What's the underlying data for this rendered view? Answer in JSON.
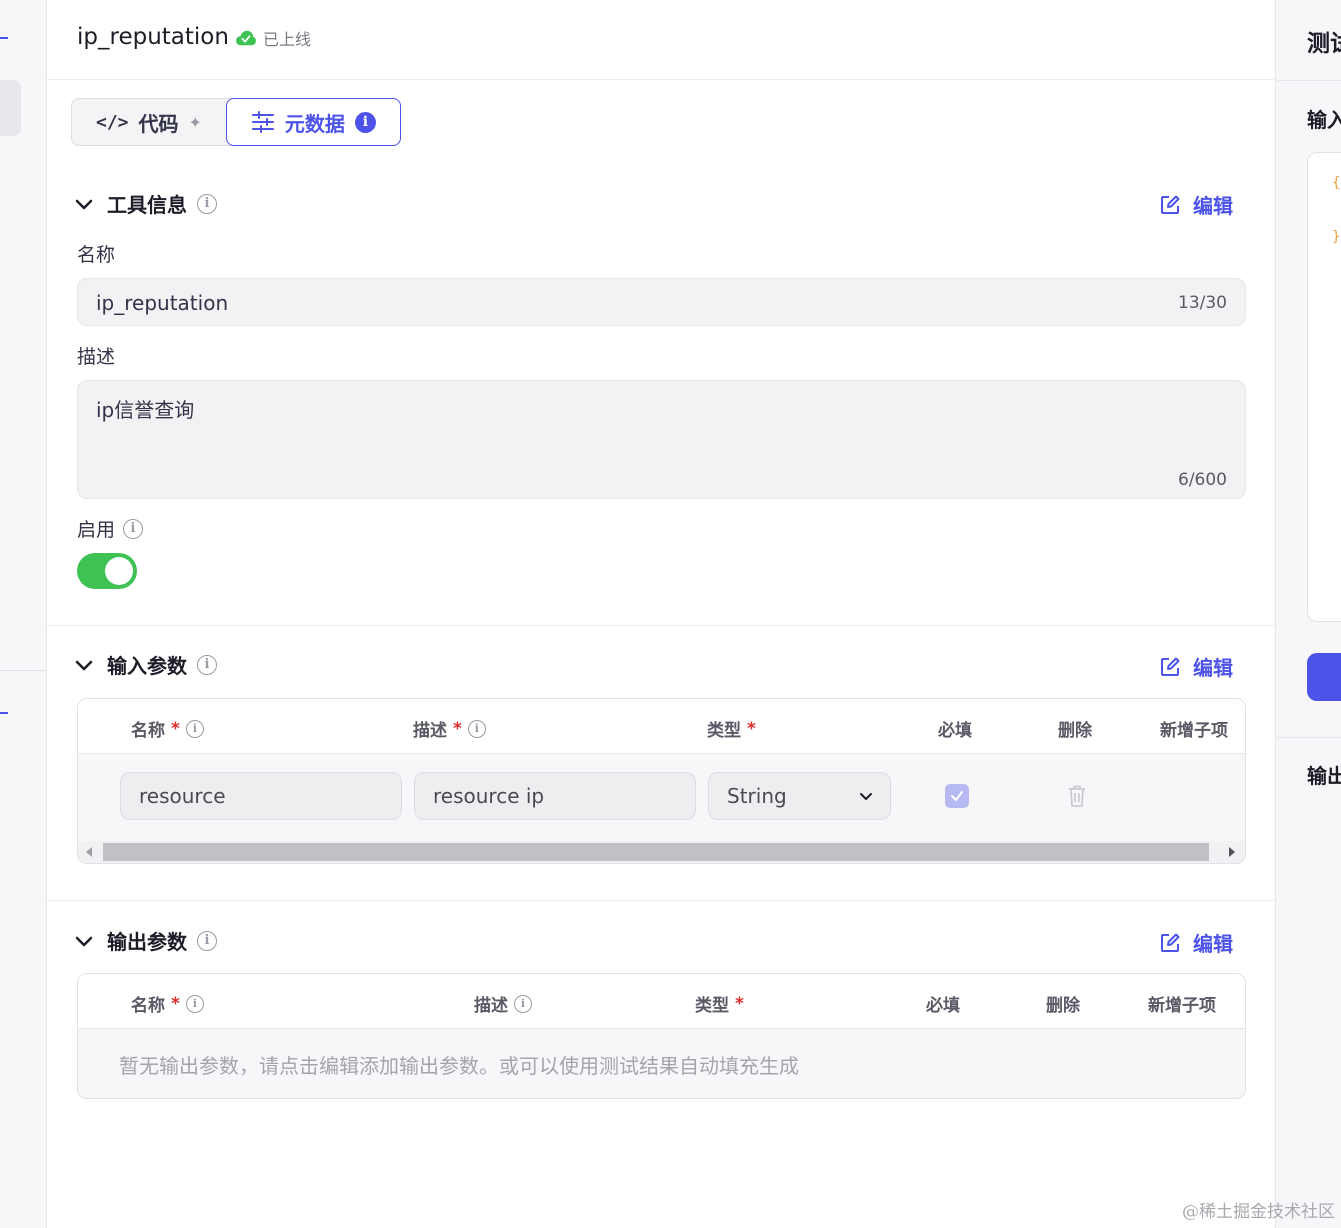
{
  "header": {
    "tool_name": "ip_reputation",
    "status": "已上线"
  },
  "tabs": [
    {
      "label": "代码",
      "icon": "code-icon"
    },
    {
      "label": "元数据",
      "icon": "sliders-icon"
    }
  ],
  "tool_info": {
    "title": "工具信息",
    "edit_label": "编辑",
    "name_label": "名称",
    "name_value": "ip_reputation",
    "name_count": "13/30",
    "desc_label": "描述",
    "desc_value": "ip信誉查询",
    "desc_count": "6/600",
    "enable_label": "启用",
    "enabled": true
  },
  "input_params": {
    "title": "输入参数",
    "edit_label": "编辑",
    "columns": {
      "name": "名称",
      "desc": "描述",
      "type": "类型",
      "required": "必填",
      "delete": "删除",
      "add_child": "新增子项"
    },
    "rows": [
      {
        "name": "resource",
        "desc": "resource ip",
        "type": "String",
        "required": true
      }
    ]
  },
  "output_params": {
    "title": "输出参数",
    "edit_label": "编辑",
    "columns": {
      "name": "名称",
      "desc": "描述",
      "type": "类型",
      "required": "必填",
      "delete": "删除",
      "add_child": "新增子项"
    },
    "empty_message": "暂无输出参数，请点击编辑添加输出参数。或可以使用测试结果自动填充生成"
  },
  "right_panel": {
    "title": "测试",
    "input_label": "输入",
    "output_label": "输出",
    "brace_open": "{",
    "brace_close": "}"
  },
  "watermark": "@稀土掘金技术社区",
  "colors": {
    "accent": "#4d53e8",
    "toggle_on": "#3ec254",
    "required": "#e02b2b",
    "status_online": "#3ec254"
  }
}
